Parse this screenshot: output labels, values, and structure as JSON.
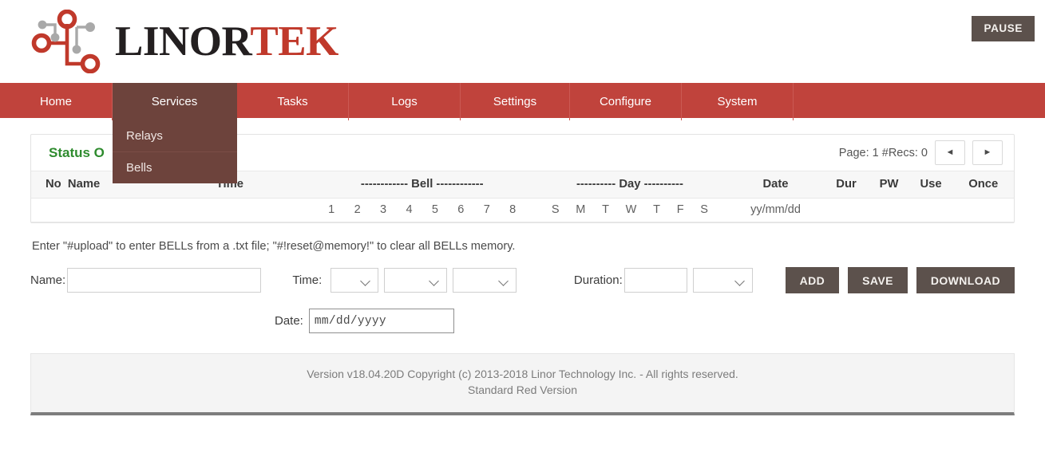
{
  "brand": {
    "word_dark": "LINOR",
    "word_red": "TEK",
    "logo_icon": "circuit-nodes-logo"
  },
  "header": {
    "pause_label": "PAUSE"
  },
  "nav": {
    "items": [
      {
        "label": "Home"
      },
      {
        "label": "Services"
      },
      {
        "label": "Tasks"
      },
      {
        "label": "Logs"
      },
      {
        "label": "Settings"
      },
      {
        "label": "Configure"
      },
      {
        "label": "System"
      }
    ],
    "open_menu": "Services",
    "dropdown": [
      {
        "label": "Relays"
      },
      {
        "label": "Bells"
      }
    ],
    "bar_color": "#c0433c",
    "open_color": "#6d433c"
  },
  "panel": {
    "title": "Status O",
    "title_color": "#2e8b2e",
    "pager_text": "Page: 1 #Recs: 0",
    "prev_icon": "triangle-left-icon",
    "next_icon": "triangle-right-icon",
    "prev_glyph": "◄",
    "next_glyph": "►"
  },
  "table": {
    "headers": [
      "No",
      "Name",
      "Time",
      "------------ Bell ------------",
      "---------- Day ----------",
      "Date",
      "Dur",
      "PW",
      "Use",
      "Once"
    ],
    "subheader": {
      "bell": [
        "1",
        "2",
        "3",
        "4",
        "5",
        "6",
        "7",
        "8"
      ],
      "day": [
        "S",
        "M",
        "T",
        "W",
        "T",
        "F",
        "S"
      ],
      "date": "yy/mm/dd"
    },
    "rows": []
  },
  "hint": "Enter \"#upload\" to enter BELLs from a .txt file; \"#!reset@memory!\" to clear all BELLs memory.",
  "form": {
    "name_label": "Name:",
    "name_value": "",
    "name_placeholder": "",
    "time_label": "Time:",
    "time_hour_value": "",
    "time_min_value": "",
    "time_ampm_value": "",
    "duration_label": "Duration:",
    "duration_value": "",
    "duration_unit_value": "",
    "date_label": "Date:",
    "date_placeholder": "mm/dd/yyyy",
    "add_label": "ADD",
    "save_label": "SAVE",
    "download_label": "DOWNLOAD",
    "button_color": "#5c514c"
  },
  "footer": {
    "line1": "Version v18.04.20D Copyright (c) 2013-2018 Linor Technology Inc. - All rights reserved.",
    "line2": "Standard Red Version"
  }
}
